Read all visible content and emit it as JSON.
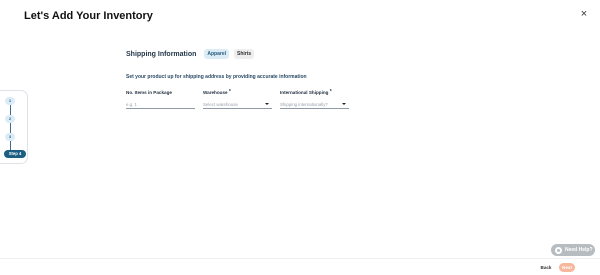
{
  "header": {
    "title": "Let's Add Your Inventory",
    "close_icon": "×"
  },
  "section": {
    "title": "Shipping Information",
    "tags": [
      "Apparel",
      "Shirts"
    ],
    "subtitle": "Set your product up for shipping address by providing accurate information"
  },
  "fields": {
    "items_in_package": {
      "label": "No. Items in Package",
      "placeholder": "e.g. 1"
    },
    "warehouse": {
      "label": "Warehouse",
      "required_mark": "*",
      "placeholder": "Select warehouse"
    },
    "international_shipping": {
      "label": "International Shipping",
      "required_mark": "*",
      "placeholder": "Shipping internationally?"
    }
  },
  "stepper": {
    "steps": [
      "1",
      "2",
      "3"
    ],
    "active_label": "Step 4"
  },
  "help": {
    "label": "Need Help?"
  },
  "footer": {
    "back_label": "Back",
    "next_label": "Next"
  },
  "colors": {
    "accent": "#1c5d82",
    "next_button": "#f7b79c",
    "help_button": "#b7bcc1"
  }
}
